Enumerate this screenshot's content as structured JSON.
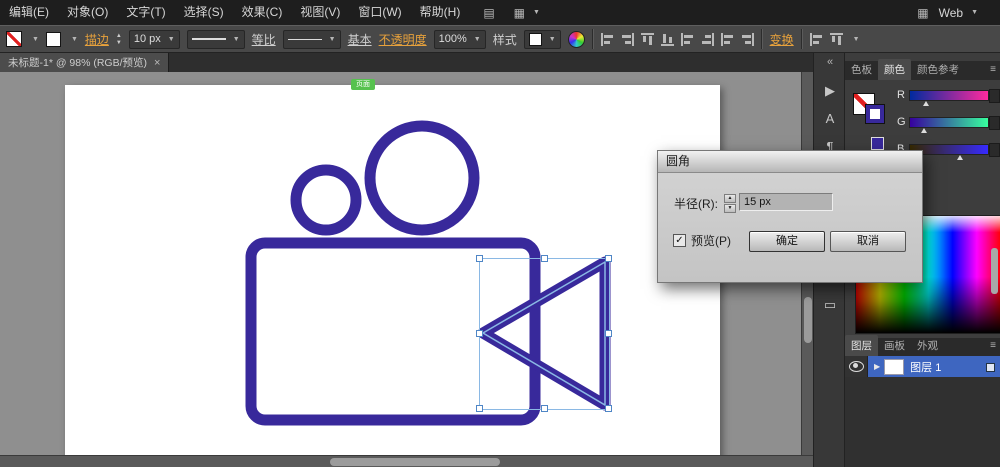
{
  "menu_bar": {
    "items": [
      "编辑(E)",
      "对象(O)",
      "文字(T)",
      "选择(S)",
      "效果(C)",
      "视图(V)",
      "窗口(W)",
      "帮助(H)"
    ],
    "workspace": "Web"
  },
  "control_bar": {
    "stroke_link": "描边",
    "stroke_width": "10 px",
    "profile": "等比",
    "brush": "基本",
    "opacity_link": "不透明度",
    "opacity": "100%",
    "style_label": "样式",
    "transform_link": "变换"
  },
  "document_tab": {
    "title": "未标题-1* @ 98% (RGB/预览)"
  },
  "canvas": {
    "artboard_tag": "页面"
  },
  "dialog": {
    "title": "圆角",
    "radius_label": "半径(R):",
    "radius_value": "15 px",
    "preview_label": "预览(P)",
    "ok": "确定",
    "cancel": "取消"
  },
  "panels": {
    "color_tabs": [
      "色板",
      "颜色",
      "颜色参考"
    ],
    "channels": [
      "R",
      "G",
      "B"
    ],
    "layer_tabs": [
      "图层",
      "画板",
      "外观"
    ],
    "layer_name": "图层 1",
    "strip_icons": [
      "▶",
      "A",
      "¶",
      "◧",
      "○",
      "▭"
    ]
  },
  "glyphs": {
    "dropdown": "▼",
    "up": "▲",
    "down": "▼",
    "close": "×",
    "collapse_left": "«",
    "panel_menu": "≡",
    "check": "✓",
    "expand": "▶",
    "window": "▤",
    "grid": "▦"
  },
  "colors": {
    "shape_purple": "#38299b",
    "selection_blue": "#8ab8e4",
    "marker_green": "#56c24e",
    "layer_selected": "#3e66c0",
    "link_orange": "#e8a23c"
  }
}
